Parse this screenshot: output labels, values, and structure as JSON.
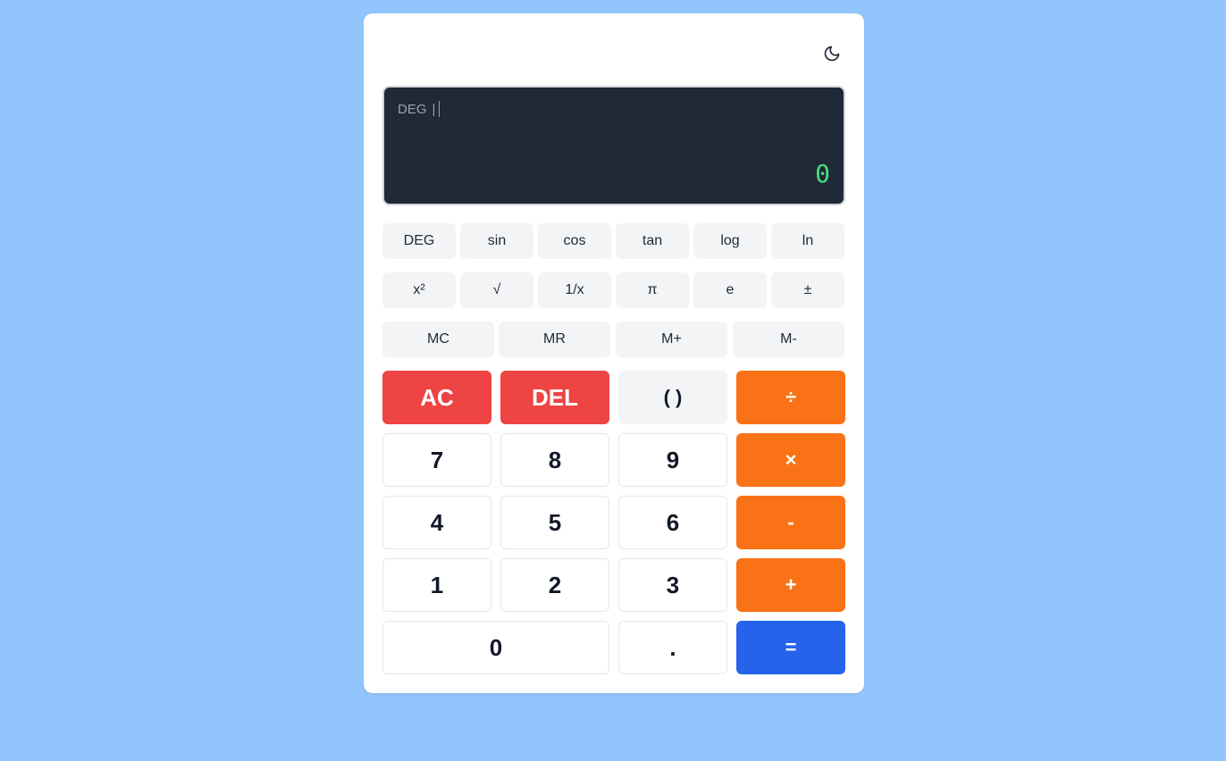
{
  "display": {
    "mode": "DEG",
    "separator": "|",
    "result": "0"
  },
  "scientific_row1": [
    "DEG",
    "sin",
    "cos",
    "tan",
    "log",
    "ln"
  ],
  "scientific_row2": [
    "x²",
    "√",
    "1/x",
    "π",
    "e",
    "±"
  ],
  "memory_row": [
    "MC",
    "MR",
    "M+",
    "M-"
  ],
  "keypad": {
    "ac": "AC",
    "del": "DEL",
    "paren": "( )",
    "divide": "÷",
    "seven": "7",
    "eight": "8",
    "nine": "9",
    "multiply": "×",
    "four": "4",
    "five": "5",
    "six": "6",
    "minus": "-",
    "one": "1",
    "two": "2",
    "three": "3",
    "plus": "+",
    "zero": "0",
    "dot": ".",
    "equals": "="
  },
  "colors": {
    "background": "#93c5fd",
    "display_bg": "#1f2937",
    "result_text": "#4ade80",
    "danger": "#ef4444",
    "operator": "#f97316",
    "equals": "#2563eb"
  },
  "icons": {
    "theme_toggle": "moon-icon"
  }
}
